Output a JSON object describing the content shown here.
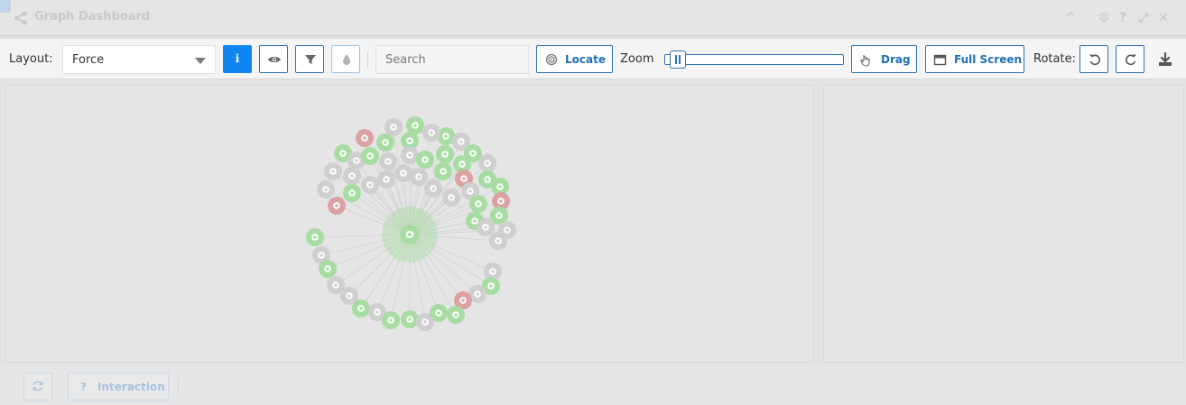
{
  "window": {
    "title": "Graph Dashboard",
    "controls": {
      "collapse": "^",
      "settings": "⚙",
      "help": "?",
      "maximize": "⤢",
      "close": "✕"
    }
  },
  "toolbar": {
    "layout_label": "Layout:",
    "layout_value": "Force",
    "info_icon_glyph": "i",
    "search_placeholder": "Search",
    "locate_label": "Locate",
    "zoom_label": "Zoom",
    "zoom_level": 0.03,
    "drag_label": "Drag",
    "fullscreen_label": "Full Screen",
    "rotate_label": "Rotate:"
  },
  "footer": {
    "interaction_label": "Interaction"
  },
  "colors": {
    "accent": "#2f74b5",
    "active": "#0f86f2",
    "node_green": "#a7dda2",
    "node_gray": "#cfcfcf",
    "node_red": "#dca2a2",
    "edge": "#d2d2d2"
  },
  "graph": {
    "nodes": [
      {
        "id": 1,
        "status": "green"
      },
      {
        "id": 2,
        "status": "gray"
      },
      {
        "id": 3,
        "status": "green"
      },
      {
        "id": 4,
        "status": "red"
      },
      {
        "id": 5,
        "status": "green"
      },
      {
        "id": 6,
        "status": "green"
      },
      {
        "id": 7,
        "status": "green"
      },
      {
        "id": 8,
        "status": "gray"
      },
      {
        "id": 9,
        "status": "green"
      },
      {
        "id": 10,
        "status": "gray"
      },
      {
        "id": 11,
        "status": "gray"
      },
      {
        "id": 12,
        "status": "green"
      },
      {
        "id": 13,
        "status": "green"
      },
      {
        "id": 14,
        "status": "green"
      },
      {
        "id": 15,
        "status": "gray"
      },
      {
        "id": 16,
        "status": "gray"
      },
      {
        "id": 17,
        "status": "gray"
      },
      {
        "id": 18,
        "status": "green"
      },
      {
        "id": 19,
        "status": "gray"
      },
      {
        "id": 20,
        "status": "gray"
      },
      {
        "id": 21,
        "status": "green"
      },
      {
        "id": 22,
        "status": "green"
      },
      {
        "id": 23,
        "status": "gray"
      },
      {
        "id": 24,
        "status": "gray"
      },
      {
        "id": 25,
        "status": "red"
      },
      {
        "id": 26,
        "status": "gray"
      },
      {
        "id": 27,
        "status": "gray"
      },
      {
        "id": 28,
        "status": "green"
      },
      {
        "id": 29,
        "status": "gray"
      },
      {
        "id": 30,
        "status": "gray"
      },
      {
        "id": 31,
        "status": "gray"
      },
      {
        "id": 32,
        "status": "green"
      },
      {
        "id": 33,
        "status": "green"
      },
      {
        "id": 34,
        "status": "red"
      },
      {
        "id": 35,
        "status": "gray"
      },
      {
        "id": 36,
        "status": "green"
      },
      {
        "id": 37,
        "status": "red"
      },
      {
        "id": 38,
        "status": "green"
      },
      {
        "id": 39,
        "status": "green"
      },
      {
        "id": 40,
        "status": "gray"
      },
      {
        "id": 41,
        "status": "gray"
      },
      {
        "id": 42,
        "status": "gray"
      },
      {
        "id": 43,
        "status": "green"
      },
      {
        "id": 44,
        "status": "gray"
      },
      {
        "id": 45,
        "status": "green"
      },
      {
        "id": 46,
        "status": "gray"
      },
      {
        "id": 47,
        "status": "gray"
      },
      {
        "id": 48,
        "status": "green"
      },
      {
        "id": 49,
        "status": "gray"
      },
      {
        "id": 50,
        "status": "gray"
      },
      {
        "id": 51,
        "status": "red"
      },
      {
        "id": 52,
        "status": "green"
      },
      {
        "id": 53,
        "status": "gray"
      },
      {
        "id": 54,
        "status": "green"
      },
      {
        "id": 55,
        "status": "green"
      },
      {
        "id": 56,
        "status": "gray"
      },
      {
        "id": 57,
        "status": "green"
      },
      {
        "id": 58,
        "status": "green"
      }
    ]
  }
}
